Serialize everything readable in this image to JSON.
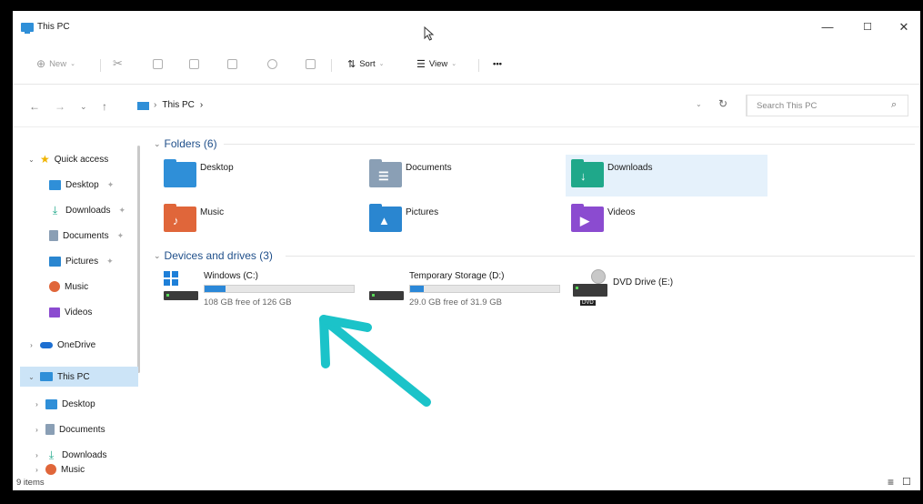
{
  "window": {
    "title": "This PC",
    "minimize": "—",
    "maximize": "☐",
    "close": "✕"
  },
  "commandbar": {
    "new_label": "New",
    "sort_label": "Sort",
    "view_label": "View",
    "more_label": "•••"
  },
  "address": {
    "crumbs": [
      "This PC",
      "›"
    ],
    "dropdown": "⌄",
    "refresh": "↻"
  },
  "search": {
    "placeholder": "Search This PC",
    "icon": "⌕"
  },
  "sidebar": {
    "quick_access": "Quick access",
    "quick_items": [
      {
        "label": "Desktop",
        "icon": "desktop-icon"
      },
      {
        "label": "Downloads",
        "icon": "download-icon"
      },
      {
        "label": "Documents",
        "icon": "documents-icon"
      },
      {
        "label": "Pictures",
        "icon": "pictures-icon"
      },
      {
        "label": "Music",
        "icon": "music-icon"
      },
      {
        "label": "Videos",
        "icon": "videos-icon"
      }
    ],
    "onedrive": "OneDrive",
    "this_pc": "This PC",
    "pc_items": [
      {
        "label": "Desktop"
      },
      {
        "label": "Documents"
      },
      {
        "label": "Downloads"
      },
      {
        "label": "Music"
      }
    ]
  },
  "main": {
    "folders_header": "Folders (6)",
    "folders": [
      {
        "label": "Desktop",
        "color": "#2f8fd8"
      },
      {
        "label": "Documents",
        "color": "#8a9fb5"
      },
      {
        "label": "Downloads",
        "color": "#1fa88a"
      },
      {
        "label": "Music",
        "color": "#e0663a"
      },
      {
        "label": "Pictures",
        "color": "#2a86d0"
      },
      {
        "label": "Videos",
        "color": "#8b4bd0"
      }
    ],
    "drives_header": "Devices and drives (3)",
    "drives": [
      {
        "label": "Windows (C:)",
        "free": "108 GB free of 126 GB",
        "used_fraction": 0.14
      },
      {
        "label": "Temporary Storage (D:)",
        "free": "29.0 GB free of 31.9 GB",
        "used_fraction": 0.09
      },
      {
        "label": "DVD Drive (E:)",
        "badge": "DVD"
      }
    ]
  },
  "status": {
    "count": "9 items",
    "details_icon": "≡",
    "tiles_icon": "☐"
  },
  "colors": {
    "accent": "#2b88d8",
    "selection": "#cce4f7",
    "annotation_arrow": "#1bc3c9"
  }
}
